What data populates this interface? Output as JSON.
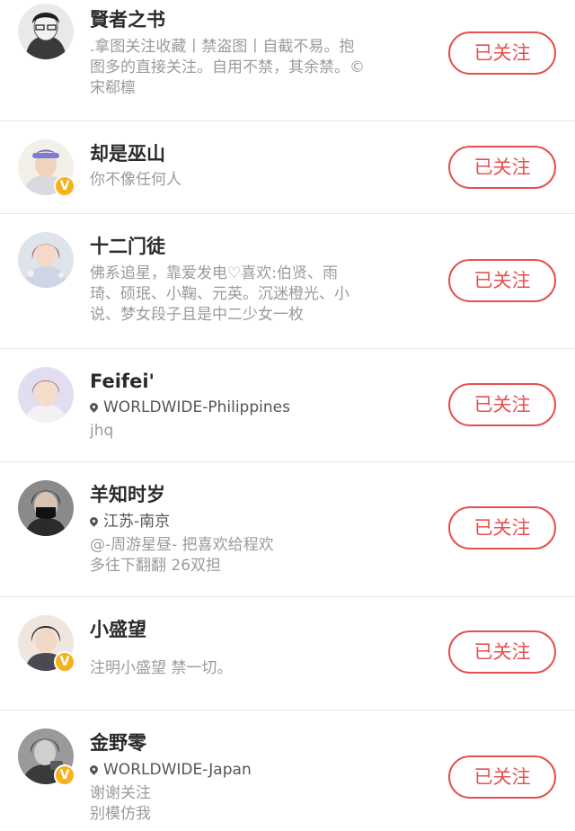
{
  "colors": {
    "accent": "#e4514f",
    "verified": "#f5b21b"
  },
  "users": [
    {
      "name": "賢者之书",
      "location": "",
      "desc_lines": [
        ".拿图关注收藏丨禁盗图丨自截不易。抱",
        "图多的直接关注。自用不禁，其余禁。©",
        "宋郗檩"
      ],
      "verified": false,
      "button": "已关注"
    },
    {
      "name": "却是巫山",
      "location": "",
      "desc_lines": [
        "你不像任何人"
      ],
      "verified": true,
      "button": "已关注"
    },
    {
      "name": "十二门徒",
      "location": "",
      "desc_lines": [
        "佛系追星，靠爱发电♡喜欢:伯贤、雨",
        "琦、硕珉、小鞠、元英。沉迷橙光、小",
        "说、梦女段子且是中二少女一枚"
      ],
      "verified": false,
      "button": "已关注"
    },
    {
      "name": "Feifei'",
      "location": "WORLDWIDE-Philippines",
      "desc_lines": [
        "jhq"
      ],
      "verified": false,
      "button": "已关注"
    },
    {
      "name": "羊知时岁",
      "location": "江苏-南京",
      "desc_lines": [
        "@-周游星昼- 把喜欢给程欢",
        "多往下翻翻  26双担"
      ],
      "verified": false,
      "button": "已关注"
    },
    {
      "name": "小盛望",
      "location": "",
      "desc_lines": [
        "注明小盛望 禁一切。"
      ],
      "verified": true,
      "button": "已关注"
    },
    {
      "name": "金野零",
      "location": "WORLDWIDE-Japan",
      "desc_lines": [
        "谢谢关注",
        "别模仿我"
      ],
      "verified": true,
      "button": "已关注"
    }
  ]
}
